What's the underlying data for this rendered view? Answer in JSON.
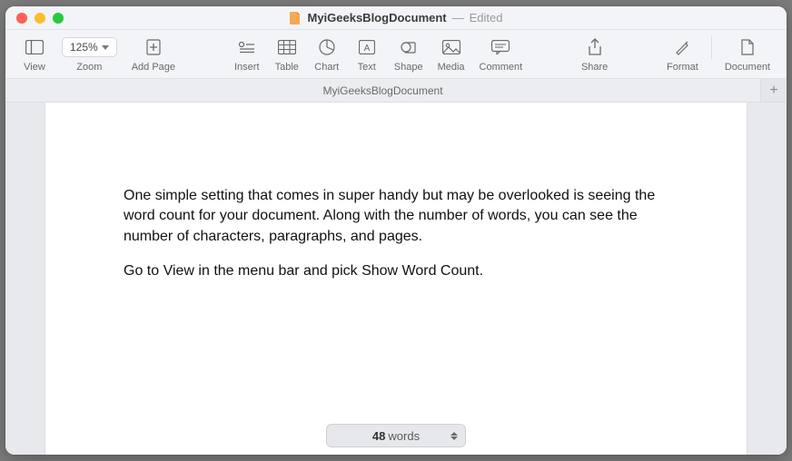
{
  "titlebar": {
    "doc_name": "MyiGeeksBlogDocument",
    "dash": " — ",
    "edited": "Edited"
  },
  "toolbar": {
    "view": "View",
    "zoom_value": "125%",
    "zoom_label": "Zoom",
    "addpage": "Add Page",
    "insert": "Insert",
    "table": "Table",
    "chart": "Chart",
    "text": "Text",
    "shape": "Shape",
    "media": "Media",
    "comment": "Comment",
    "share": "Share",
    "format": "Format",
    "document": "Document"
  },
  "tabs": {
    "active": "MyiGeeksBlogDocument",
    "plus": "+"
  },
  "document": {
    "para1": "One simple setting that comes in super handy but may be overlooked is seeing the word count for your document. Along with the number of words, you can see the number of characters, paragraphs, and pages.",
    "para2": "Go to View in the menu bar and pick Show Word Count."
  },
  "wordcount": {
    "count": "48",
    "label": "words"
  }
}
